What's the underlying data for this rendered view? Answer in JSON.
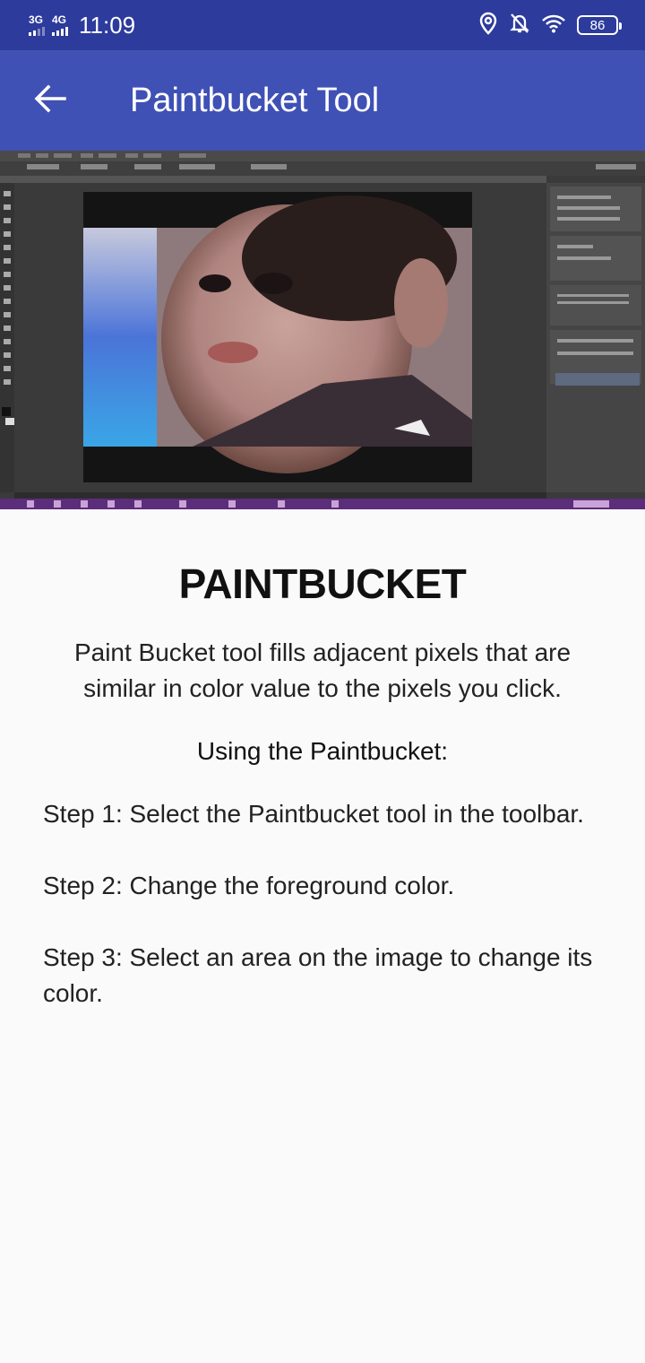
{
  "status_bar": {
    "net1": "3G",
    "net2": "4G",
    "time": "11:09",
    "battery": "86"
  },
  "app_bar": {
    "title": "Paintbucket Tool",
    "back_icon": "arrow-left-icon"
  },
  "hero_image": {
    "description_icon": "photoshop-screenshot-image"
  },
  "content": {
    "heading": "PAINTBUCKET",
    "description": "Paint Bucket tool fills adjacent pixels that are similar in color value to the pixels you click.",
    "subheading": "Using the Paintbucket:",
    "steps": [
      "Step 1: Select the Paintbucket tool in the toolbar.",
      "Step 2: Change the foreground color.",
      "Step 3: Select an area on the image to change its color."
    ]
  },
  "colors": {
    "status_bar": "#2d3b9c",
    "app_bar": "#3f51b5",
    "background": "#fafafa"
  }
}
